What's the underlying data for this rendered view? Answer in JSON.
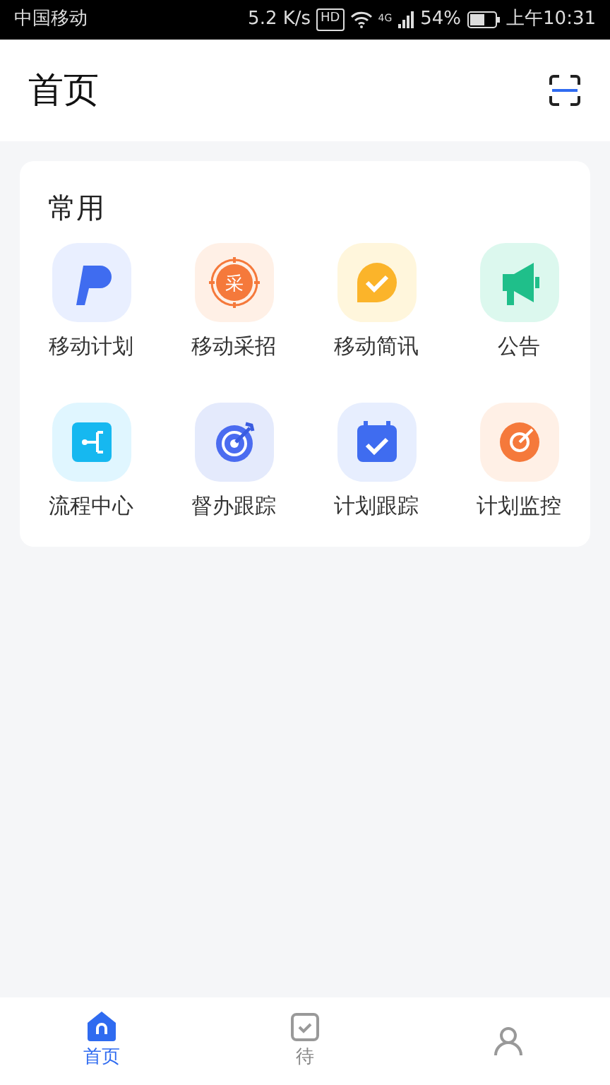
{
  "status_bar": {
    "carrier": "中国移动",
    "speed": "5.2 K/s",
    "hd": "HD",
    "network": "4G",
    "battery": "54%",
    "time": "上午10:31"
  },
  "header": {
    "title": "首页"
  },
  "section": {
    "title": "常用",
    "items": [
      {
        "label": "移动计划",
        "kind": "plan"
      },
      {
        "label": "移动采招",
        "kind": "procure",
        "glyph": "采"
      },
      {
        "label": "移动简讯",
        "kind": "news"
      },
      {
        "label": "公告",
        "kind": "notice"
      },
      {
        "label": "流程中心",
        "kind": "flow"
      },
      {
        "label": "督办跟踪",
        "kind": "target"
      },
      {
        "label": "计划跟踪",
        "kind": "calendar"
      },
      {
        "label": "计划监控",
        "kind": "monitor"
      }
    ]
  },
  "tab_bar": [
    {
      "label": "首页",
      "kind": "home",
      "selected": true
    },
    {
      "label": "待",
      "kind": "todo",
      "selected": false
    },
    {
      "kind": "mine",
      "selected": false
    }
  ]
}
